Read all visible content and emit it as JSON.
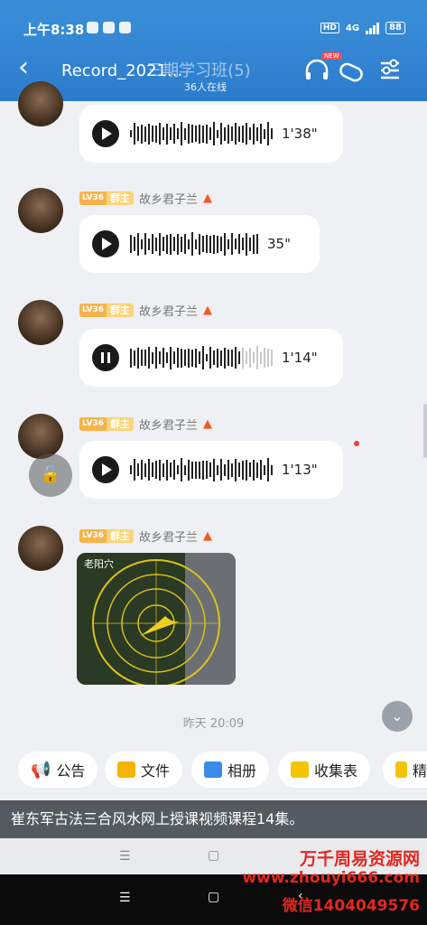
{
  "status_bar": {
    "time": "上午8:38",
    "hd": "HD",
    "network": "4G",
    "battery": "88"
  },
  "header": {
    "back_icon": "chevron-left-icon",
    "title": "Record_2021...",
    "title_suffix": "三期学习班(5)",
    "online": "36人在线",
    "new_badge": "NEW"
  },
  "messages": [
    {
      "type": "voice",
      "duration": "1'38\"",
      "playing": false
    },
    {
      "type": "voice",
      "level": "LV36",
      "role": "群主",
      "sender": "故乡君子兰",
      "duration": "35\"",
      "playing": false
    },
    {
      "type": "voice",
      "level": "LV36",
      "role": "群主",
      "sender": "故乡君子兰",
      "duration": "1'14\"",
      "playing": true,
      "progress": 0.75
    },
    {
      "type": "voice",
      "level": "LV36",
      "role": "群主",
      "sender": "故乡君子兰",
      "duration": "1'13\"",
      "playing": false
    },
    {
      "type": "image",
      "level": "LV36",
      "role": "群主",
      "sender": "故乡君子兰",
      "image_label": "老阳穴"
    }
  ],
  "timestamp": "昨天 20:09",
  "quick_actions": [
    {
      "label": "公告",
      "icon": "megaphone-icon",
      "color": "#2f8ff0"
    },
    {
      "label": "文件",
      "icon": "folder-icon",
      "color": "#f5b400"
    },
    {
      "label": "相册",
      "icon": "photo-icon",
      "color": "#3b8ce8"
    },
    {
      "label": "收集表",
      "icon": "form-icon",
      "color": "#f5c400"
    },
    {
      "label": "精",
      "icon": "essence-icon",
      "color": "#f5c400"
    }
  ],
  "caption": "崔东军古法三合风水网上授课视频课程14集。",
  "watermark": {
    "line1": "万千周易资源网",
    "line2": "www.zhouyi666.com",
    "line3": "微信1404049576"
  }
}
